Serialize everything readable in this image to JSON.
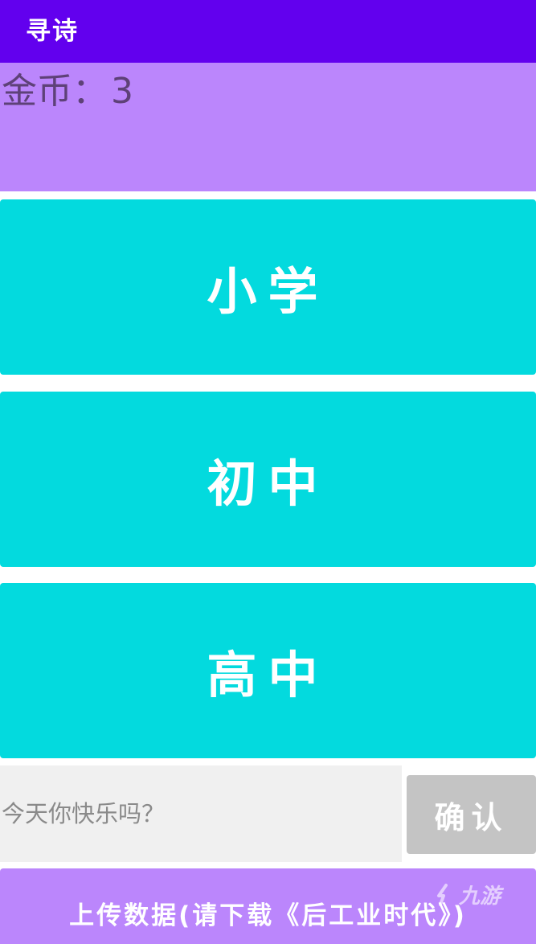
{
  "app_bar": {
    "title": "寻诗"
  },
  "coins": {
    "label": "金币：",
    "value": "3"
  },
  "levels": [
    {
      "label": "小学"
    },
    {
      "label": "初中"
    },
    {
      "label": "高中"
    }
  ],
  "answer": {
    "value": "",
    "placeholder": "今天你快乐吗？"
  },
  "confirm_button": {
    "label": "确认"
  },
  "upload_button": {
    "label": "上传数据(请下载《后工业时代》)"
  },
  "watermark": {
    "text": "九游"
  },
  "colors": {
    "app_bar": "#6200ee",
    "panel_purple": "#bb86fc",
    "level_button": "#03dade",
    "confirm_button": "#c4c4c4",
    "input_background": "#f0f0f0"
  }
}
